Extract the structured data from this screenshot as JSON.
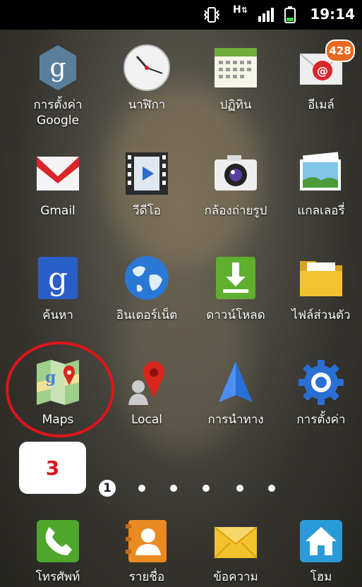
{
  "status": {
    "time": "19:14",
    "network": "H"
  },
  "apps": [
    {
      "label": "การตั้งค่า Google",
      "icon": "google-settings-icon"
    },
    {
      "label": "นาฬิกา",
      "icon": "clock-icon"
    },
    {
      "label": "ปฏิทิน",
      "icon": "calendar-icon"
    },
    {
      "label": "อีเมล์",
      "icon": "email-icon",
      "badge": "428"
    },
    {
      "label": "Gmail",
      "icon": "gmail-icon"
    },
    {
      "label": "วีดีโอ",
      "icon": "video-icon"
    },
    {
      "label": "กล้องถ่ายรูป",
      "icon": "camera-icon"
    },
    {
      "label": "แกลเลอรี่",
      "icon": "gallery-icon"
    },
    {
      "label": "ค้นหา",
      "icon": "google-search-icon"
    },
    {
      "label": "อินเตอร์เน็ต",
      "icon": "internet-globe-icon"
    },
    {
      "label": "ดาวน์โหลด",
      "icon": "download-icon"
    },
    {
      "label": "ไฟล์ส่วนตัว",
      "icon": "folder-icon"
    },
    {
      "label": "Maps",
      "icon": "maps-icon"
    },
    {
      "label": "Local",
      "icon": "local-pin-icon"
    },
    {
      "label": "การนำทาง",
      "icon": "navigation-arrow-icon"
    },
    {
      "label": "การตั้งค่า",
      "icon": "settings-gear-icon"
    }
  ],
  "step_marker": "3",
  "page_indicator": {
    "current": "1",
    "total": 6
  },
  "dock": [
    {
      "label": "โทรศัพท์",
      "icon": "phone-icon"
    },
    {
      "label": "รายชื่อ",
      "icon": "contacts-icon"
    },
    {
      "label": "ข้อความ",
      "icon": "messages-icon"
    },
    {
      "label": "โฮม",
      "icon": "home-icon"
    }
  ],
  "colors": {
    "highlight": "#e0141a",
    "badge": "#e8691f"
  }
}
